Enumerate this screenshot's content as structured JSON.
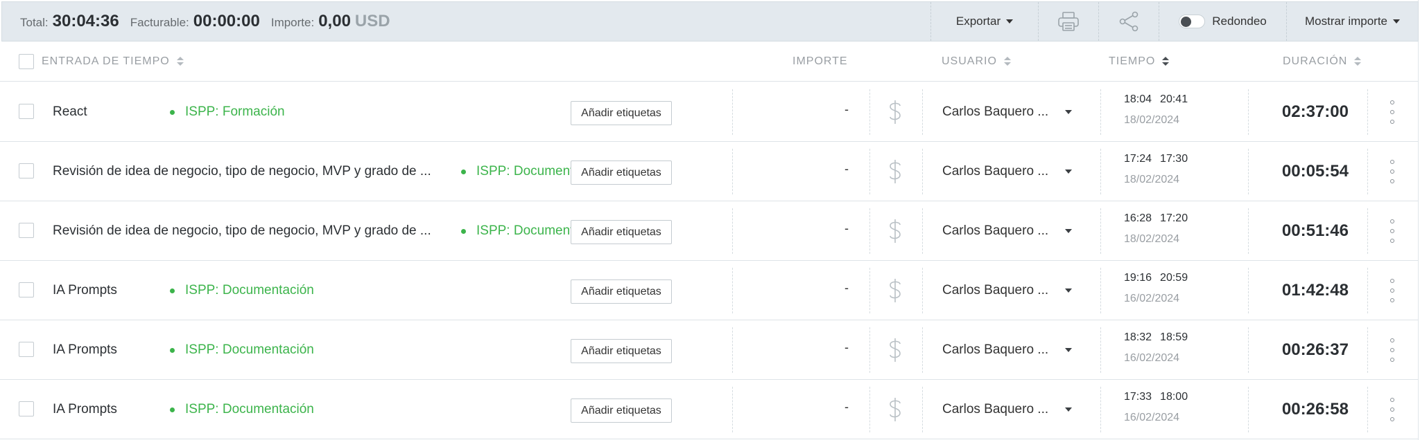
{
  "summary": {
    "total_label": "Total:",
    "total_value": "30:04:36",
    "billable_label": "Facturable:",
    "billable_value": "00:00:00",
    "amount_label": "Importe:",
    "amount_value": "0,00",
    "amount_currency": "USD",
    "export_label": "Exportar",
    "rounding_label": "Redondeo",
    "rounding_enabled": false,
    "show_amount_label": "Mostrar importe"
  },
  "table_header": {
    "time_entry": "ENTRADA DE TIEMPO",
    "amount": "IMPORTE",
    "user": "USUARIO",
    "time": "TIEMPO",
    "duration": "DURACIÓN"
  },
  "colors": {
    "project_green": "#3cb44b",
    "summary_bg": "#e3e9ee"
  },
  "icons": {
    "print": "printer-icon",
    "share": "share-icon",
    "billable": "dollar-icon",
    "more": "more-vertical-icon"
  },
  "entries": [
    {
      "description": "React",
      "project": "ISPP: Formación",
      "tags_label": "Añadir etiquetas",
      "amount": "-",
      "user": "Carlos Baquero ...",
      "start": "18:04",
      "end": "20:41",
      "date": "18/02/2024",
      "duration": "02:37:00"
    },
    {
      "description": "Revisión de idea de negocio, tipo de negocio, MVP y grado de ...",
      "project": "ISPP: Documentación",
      "tags_label": "Añadir etiquetas",
      "amount": "-",
      "user": "Carlos Baquero ...",
      "start": "17:24",
      "end": "17:30",
      "date": "18/02/2024",
      "duration": "00:05:54"
    },
    {
      "description": "Revisión de idea de negocio, tipo de negocio, MVP y grado de ...",
      "project": "ISPP: Documentación",
      "tags_label": "Añadir etiquetas",
      "amount": "-",
      "user": "Carlos Baquero ...",
      "start": "16:28",
      "end": "17:20",
      "date": "18/02/2024",
      "duration": "00:51:46"
    },
    {
      "description": "IA Prompts",
      "project": "ISPP: Documentación",
      "tags_label": "Añadir etiquetas",
      "amount": "-",
      "user": "Carlos Baquero ...",
      "start": "19:16",
      "end": "20:59",
      "date": "16/02/2024",
      "duration": "01:42:48"
    },
    {
      "description": "IA Prompts",
      "project": "ISPP: Documentación",
      "tags_label": "Añadir etiquetas",
      "amount": "-",
      "user": "Carlos Baquero ...",
      "start": "18:32",
      "end": "18:59",
      "date": "16/02/2024",
      "duration": "00:26:37"
    },
    {
      "description": "IA Prompts",
      "project": "ISPP: Documentación",
      "tags_label": "Añadir etiquetas",
      "amount": "-",
      "user": "Carlos Baquero ...",
      "start": "17:33",
      "end": "18:00",
      "date": "16/02/2024",
      "duration": "00:26:58"
    }
  ]
}
